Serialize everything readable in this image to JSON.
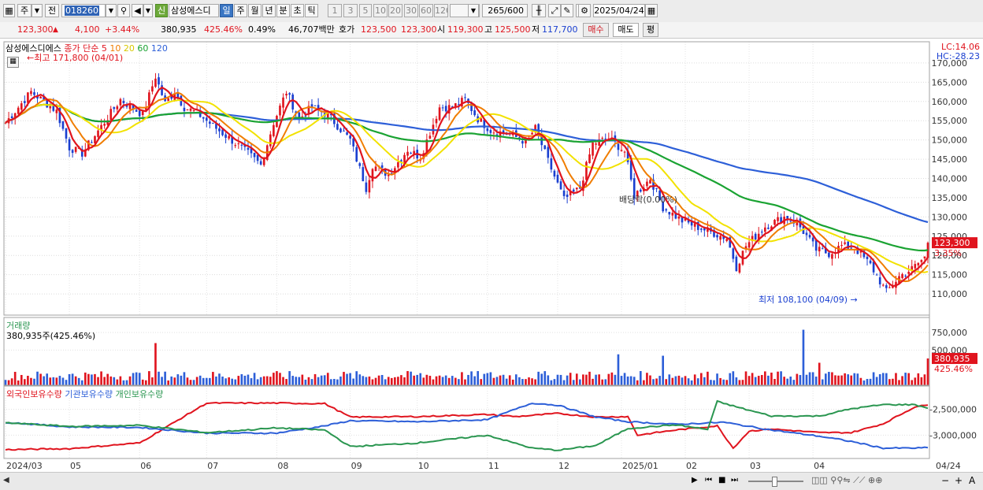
{
  "toolbar": {
    "left_box": "주",
    "prefix_box": "전",
    "code": "018260",
    "type_badge": "신",
    "stock_name": "삼성에스디",
    "periods": [
      "일",
      "주",
      "월",
      "년",
      "분",
      "초",
      "틱"
    ],
    "active_period": "일",
    "intervals": [
      "1",
      "3",
      "5",
      "10",
      "20",
      "30",
      "60",
      "120"
    ],
    "count": "265",
    "count_total": "/600",
    "date": "2025/04/24"
  },
  "quote": {
    "price": "123,300",
    "change": "4,100",
    "change_pct": "+3.44%",
    "volume": "380,935",
    "volume_ratio": "425.46%",
    "turnover": "0.49%",
    "amount": "46,707백만",
    "ask_label": "호가",
    "ask": "123,500",
    "bid": "123,300",
    "open_label": "시",
    "open": "119,300",
    "high_label": "고",
    "high": "125,500",
    "low_label": "저",
    "low": "117,700",
    "buy_label": "매수",
    "sell_label": "매도",
    "eval_label": "평"
  },
  "colors": {
    "price_up": "#e0141e",
    "price_down": "#1a3fd0",
    "ma5": "#e0141e",
    "ma10": "#f07d00",
    "ma20": "#f2e200",
    "ma60": "#1aa332",
    "ma120": "#2d5fd8",
    "foreign": "#e0141e",
    "institution": "#2d5fd8",
    "individual": "#2a9650",
    "volume_down": "#2d5fd8",
    "volume_up": "#e0141e"
  },
  "chart_data": [
    {
      "type": "candlestick",
      "title": "삼성에스디에스",
      "legend_prefix": "종가 단순",
      "ma_periods": [
        "5",
        "10",
        "20",
        "60",
        "120"
      ],
      "lc": "LC:14.06",
      "hc": "HC:-28.23",
      "y_ticks": [
        "110,000",
        "115,000",
        "120,000",
        "125,000",
        "130,000",
        "135,000",
        "140,000",
        "145,000",
        "150,000",
        "155,000",
        "160,000",
        "165,000",
        "170,000"
      ],
      "y_tick_values": [
        110000,
        115000,
        120000,
        125000,
        130000,
        135000,
        140000,
        145000,
        150000,
        155000,
        160000,
        165000,
        170000
      ],
      "ylim": [
        104500,
        175500
      ],
      "x_labels": [
        "2024/03",
        "05",
        "06",
        "07",
        "08",
        "09",
        "10",
        "11",
        "12",
        "2025/01",
        "02",
        "03",
        "04",
        "04/24"
      ],
      "current_price_label": "123,300",
      "current_pct_label": "3.35%",
      "max_annotation": "최고 171,800 (04/01)",
      "min_annotation": "최저 108,100 (04/09)",
      "dividend_annotation": "배당락(0.00%)",
      "close_anchors": [
        [
          0,
          154500
        ],
        [
          8,
          162500
        ],
        [
          16,
          157500
        ],
        [
          20,
          148000
        ],
        [
          24,
          146500
        ],
        [
          30,
          153500
        ],
        [
          36,
          160500
        ],
        [
          43,
          156500
        ],
        [
          47,
          166500
        ],
        [
          50,
          159500
        ],
        [
          53,
          162500
        ],
        [
          56,
          158500
        ],
        [
          60,
          157000
        ],
        [
          66,
          153000
        ],
        [
          70,
          150500
        ],
        [
          76,
          146500
        ],
        [
          80,
          143500
        ],
        [
          84,
          154500
        ],
        [
          88,
          162500
        ],
        [
          92,
          155500
        ],
        [
          96,
          158500
        ],
        [
          101,
          156500
        ],
        [
          108,
          150000
        ],
        [
          113,
          137500
        ],
        [
          115,
          143500
        ],
        [
          120,
          141000
        ],
        [
          126,
          147500
        ],
        [
          130,
          145500
        ],
        [
          136,
          158500
        ],
        [
          140,
          158500
        ],
        [
          144,
          160500
        ],
        [
          148,
          155500
        ],
        [
          152,
          152500
        ],
        [
          158,
          151500
        ],
        [
          163,
          149500
        ],
        [
          166,
          153000
        ],
        [
          170,
          144500
        ],
        [
          175,
          134500
        ],
        [
          180,
          137500
        ],
        [
          184,
          149000
        ],
        [
          189,
          150500
        ],
        [
          194,
          147000
        ],
        [
          197,
          135500
        ],
        [
          202,
          140000
        ],
        [
          206,
          132500
        ],
        [
          212,
          129000
        ],
        [
          218,
          127000
        ],
        [
          226,
          124500
        ],
        [
          229,
          117000
        ],
        [
          232,
          122500
        ],
        [
          238,
          127500
        ],
        [
          244,
          130000
        ],
        [
          248,
          128500
        ],
        [
          254,
          121500
        ],
        [
          258,
          120500
        ],
        [
          262,
          122500
        ],
        [
          266,
          122000
        ],
        [
          271,
          117500
        ],
        [
          276,
          110500
        ],
        [
          280,
          114500
        ],
        [
          284,
          116500
        ],
        [
          288,
          119500
        ],
        [
          289,
          123300
        ]
      ]
    },
    {
      "type": "bar",
      "title": "거래량",
      "value_label": "380,935주(425.46%)",
      "y_ticks": [
        "750,000",
        "500,000"
      ],
      "y_tick_values": [
        750000,
        500000
      ],
      "ylim": [
        0,
        830000
      ],
      "current_label": "380,935",
      "current_pct": "425.46%",
      "base_volume": 150000,
      "spikes": [
        [
          47,
          600000
        ],
        [
          192,
          440000
        ],
        [
          206,
          420000
        ],
        [
          250,
          790000
        ],
        [
          255,
          320000
        ],
        [
          289,
          380935
        ]
      ]
    },
    {
      "type": "line",
      "series_names": [
        "외국인보유수량",
        "기관보유수량",
        "개인보유수량"
      ],
      "y_ticks": [
        "-2,500,000",
        "-3,000,000"
      ],
      "y_tick_values": [
        -2500000,
        -3000000
      ],
      "ylim": [
        -3450000,
        -2050000
      ]
    }
  ]
}
